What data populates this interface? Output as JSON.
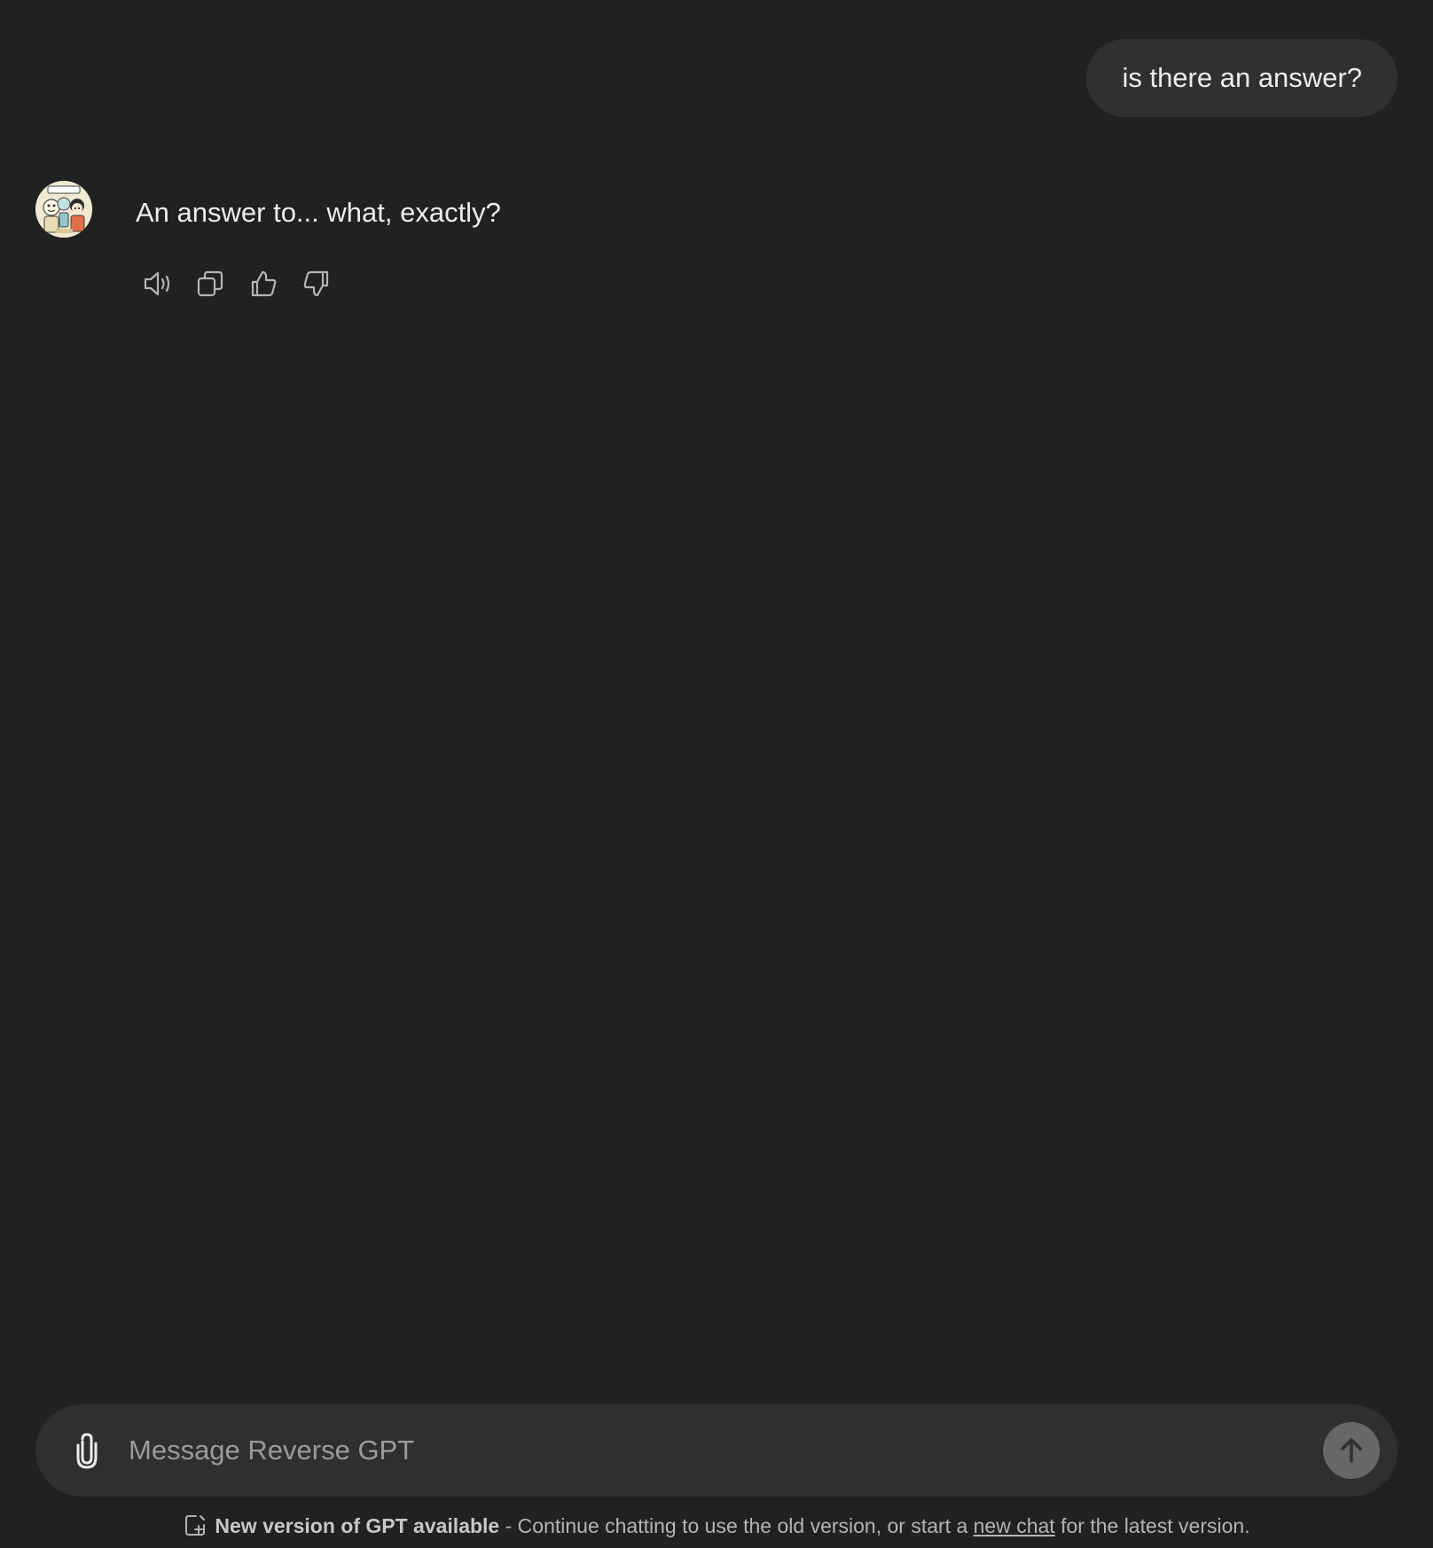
{
  "conversation": {
    "user_message": "is there an answer?",
    "assistant_message": "An answer to... what, exactly?",
    "assistant_avatar": "gpt-avatar-illustration",
    "actions": [
      {
        "name": "read-aloud",
        "icon": "speaker-icon"
      },
      {
        "name": "copy",
        "icon": "copy-icon"
      },
      {
        "name": "good-response",
        "icon": "thumbs-up-icon"
      },
      {
        "name": "bad-response",
        "icon": "thumbs-down-icon"
      }
    ]
  },
  "composer": {
    "placeholder": "Message Reverse GPT",
    "attach_icon": "paperclip-icon",
    "send_icon": "arrow-up-icon"
  },
  "footer": {
    "icon": "new-chat-icon",
    "title": "New version of GPT available",
    "text_before": " - Continue chatting to use the old version, or start a ",
    "link": "new chat",
    "text_after": " for the latest version."
  },
  "colors": {
    "background": "#212121",
    "bubble": "#303030",
    "composer": "#2f2f2f",
    "send_button": "#676767",
    "text": "#ececec",
    "muted": "#b4b4b4"
  }
}
